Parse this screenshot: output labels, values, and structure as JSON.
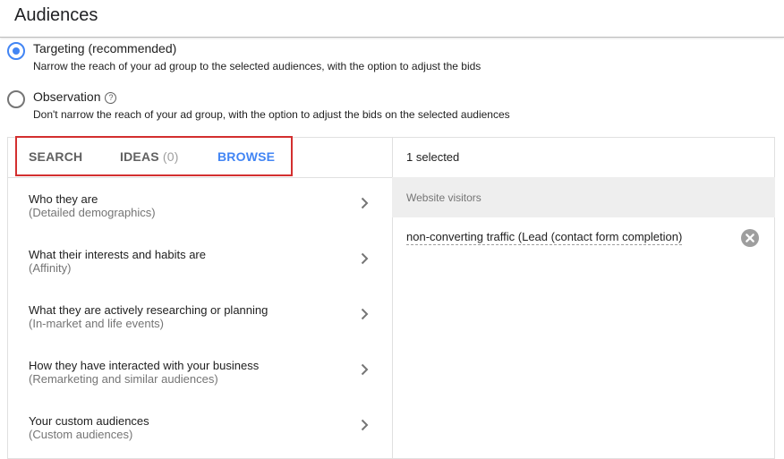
{
  "page": {
    "title": "Audiences"
  },
  "options": [
    {
      "label": "Targeting (recommended)",
      "description": "Narrow the reach of your ad group to the selected audiences, with the option to adjust the bids",
      "checked": true
    },
    {
      "label": "Observation",
      "description": "Don't narrow the reach of your ad group, with the option to adjust the bids on the selected audiences",
      "checked": false,
      "help_icon": "help-circle-icon"
    }
  ],
  "tabs": [
    {
      "label": "SEARCH"
    },
    {
      "label": "IDEAS",
      "count": "(0)"
    },
    {
      "label": "BROWSE",
      "active": true
    }
  ],
  "browse_items": [
    {
      "title": "Who they are",
      "subtitle": "(Detailed demographics)"
    },
    {
      "title": "What their interests and habits are",
      "subtitle": "(Affinity)"
    },
    {
      "title": "What they are actively researching or planning",
      "subtitle": "(In-market and life events)"
    },
    {
      "title": "How they have interacted with your business",
      "subtitle": "(Remarketing and similar audiences)"
    },
    {
      "title": "Your custom audiences",
      "subtitle": "(Custom audiences)"
    }
  ],
  "selection": {
    "count_label": "1 selected",
    "group_label": "Website visitors",
    "items": [
      {
        "label": "non-converting traffic (Lead (contact form completion)",
        "remove_icon": "remove-circle-icon"
      }
    ]
  },
  "colors": {
    "accent": "#4285f4",
    "highlight": "#d32f2f",
    "group_bg": "#eeeeee"
  }
}
